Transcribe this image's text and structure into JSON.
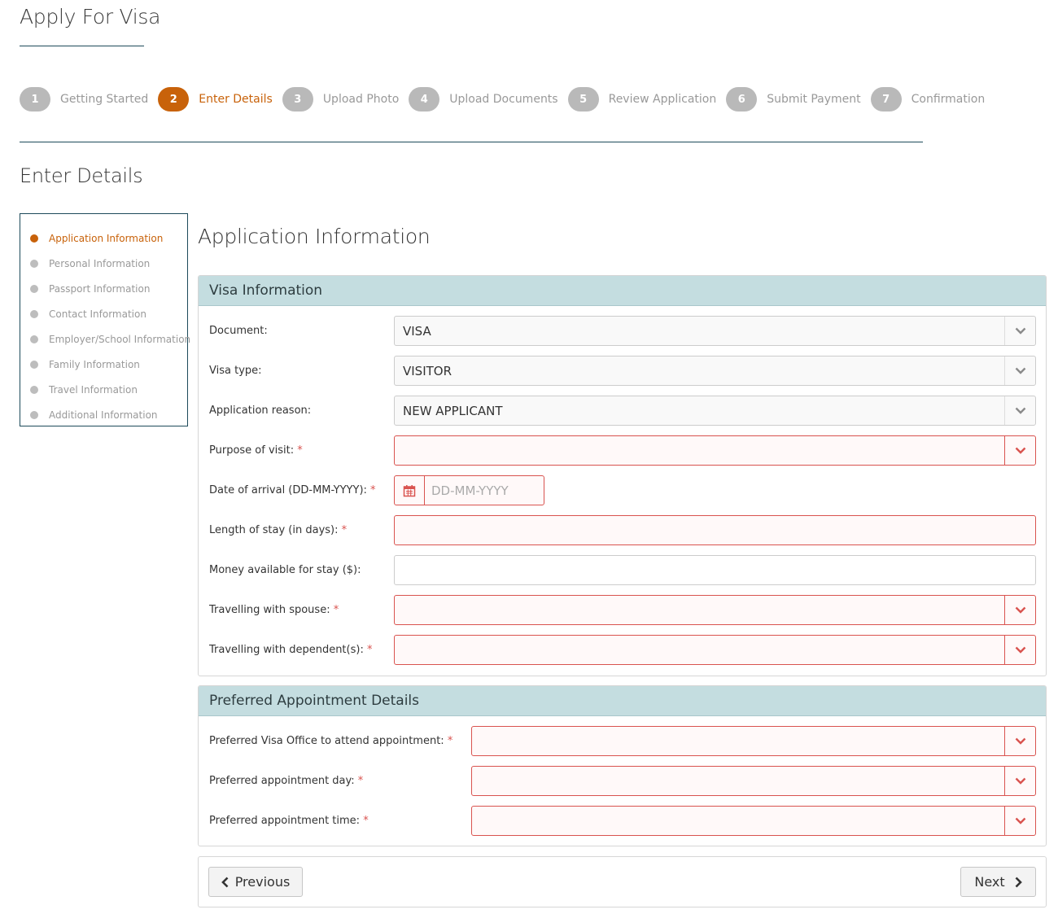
{
  "page": {
    "title": "Apply For Visa"
  },
  "stepper": {
    "steps": [
      {
        "number": "1",
        "label": "Getting Started"
      },
      {
        "number": "2",
        "label": "Enter Details"
      },
      {
        "number": "3",
        "label": "Upload Photo"
      },
      {
        "number": "4",
        "label": "Upload Documents"
      },
      {
        "number": "5",
        "label": "Review Application"
      },
      {
        "number": "6",
        "label": "Submit Payment"
      },
      {
        "number": "7",
        "label": "Confirmation"
      }
    ],
    "active_step": "2"
  },
  "section": {
    "title": "Enter Details"
  },
  "sidebar": {
    "items": [
      {
        "label": "Application Information"
      },
      {
        "label": "Personal Information"
      },
      {
        "label": "Passport Information"
      },
      {
        "label": "Contact Information"
      },
      {
        "label": "Employer/School Information"
      },
      {
        "label": "Family Information"
      },
      {
        "label": "Travel Information"
      },
      {
        "label": "Additional Information"
      }
    ]
  },
  "content": {
    "title": "Application Information"
  },
  "visa_info": {
    "heading": "Visa Information",
    "document": {
      "label": "Document:",
      "value": "VISA"
    },
    "visa_type": {
      "label": "Visa type:",
      "value": "VISITOR"
    },
    "application_reason": {
      "label": "Application reason:",
      "value": "NEW APPLICANT"
    },
    "purpose_of_visit": {
      "label": "Purpose of visit:",
      "value": ""
    },
    "date_of_arrival": {
      "label": "Date of arrival (DD-MM-YYYY):",
      "placeholder": "DD-MM-YYYY"
    },
    "length_of_stay": {
      "label": "Length of stay (in days):",
      "value": ""
    },
    "money_available": {
      "label": "Money available for stay ($):",
      "value": ""
    },
    "travelling_with_spouse": {
      "label": "Travelling with spouse:",
      "value": ""
    },
    "travelling_with_dependents": {
      "label": "Travelling with dependent(s):",
      "value": ""
    }
  },
  "appointment": {
    "heading": "Preferred Appointment Details",
    "visa_office": {
      "label": "Preferred Visa Office to attend appointment:",
      "value": ""
    },
    "day": {
      "label": "Preferred appointment day:",
      "value": ""
    },
    "time": {
      "label": "Preferred appointment time:",
      "value": ""
    }
  },
  "required_marker": "*",
  "nav_buttons": {
    "previous": "Previous",
    "next": "Next"
  },
  "colors": {
    "accent": "#c8620a",
    "panel_header": "#c4dde0",
    "error": "#d9534f",
    "rule": "#1d4a5a"
  },
  "icons": {
    "select_arrow": "chevron-down-icon",
    "date": "calendar-icon",
    "previous": "chevron-left-icon",
    "next": "chevron-right-icon"
  }
}
